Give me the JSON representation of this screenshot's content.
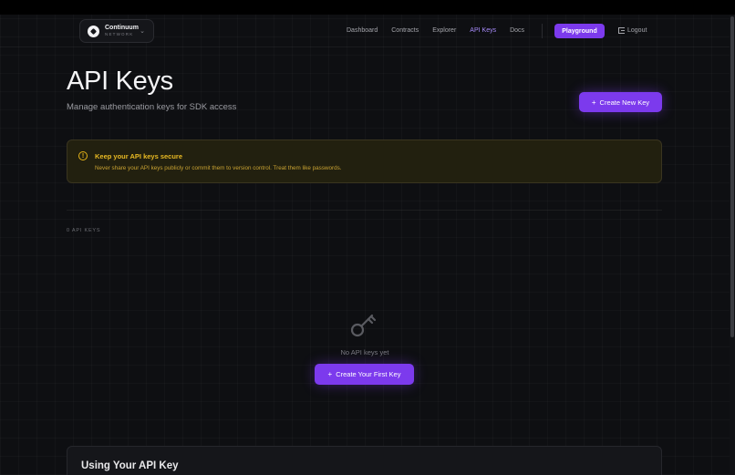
{
  "brand": {
    "name": "Continuum",
    "sub": "NETWORK"
  },
  "nav": {
    "links": [
      {
        "label": "Dashboard",
        "active": false
      },
      {
        "label": "Contracts",
        "active": false
      },
      {
        "label": "Explorer",
        "active": false
      },
      {
        "label": "API Keys",
        "active": true
      },
      {
        "label": "Docs",
        "active": false
      }
    ],
    "playground": "Playground",
    "logout": "Logout"
  },
  "page": {
    "title": "API Keys",
    "subtitle": "Manage authentication keys for SDK access",
    "create_button": "Create New Key"
  },
  "warning": {
    "icon": "alert-circle-icon",
    "title": "Keep your API keys secure",
    "text": "Never share your API keys publicly or commit them to version control. Treat them like passwords."
  },
  "keys": {
    "count_label": "0 API KEYS",
    "empty_icon": "key-icon",
    "empty_text": "No API keys yet",
    "first_key_button": "Create Your First Key"
  },
  "using": {
    "title": "Using Your API Key"
  },
  "colors": {
    "accent": "#7c3aed",
    "accent_text": "#a78bfa",
    "warning": "#e8b923",
    "background": "#0e0f12"
  }
}
